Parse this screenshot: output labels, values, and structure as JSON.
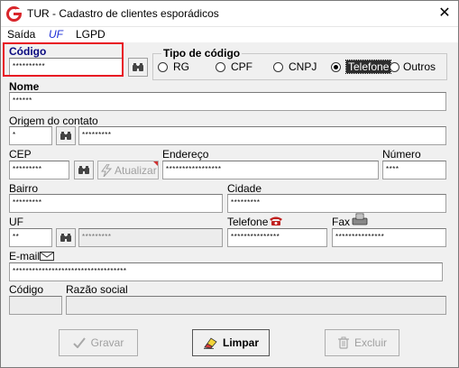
{
  "window": {
    "title": "TUR - Cadastro de clientes esporádicos",
    "close_glyph": "✕"
  },
  "menu": {
    "items": [
      "Saída",
      "UF",
      "LGPD"
    ]
  },
  "form": {
    "codigo": {
      "label": "Código",
      "value": "**********"
    },
    "tipo_codigo": {
      "title": "Tipo de código",
      "options": [
        "RG",
        "CPF",
        "CNPJ",
        "Telefone",
        "Outros"
      ],
      "selected": "Telefone"
    },
    "nome": {
      "label": "Nome",
      "value": "******"
    },
    "origem": {
      "label": "Origem do contato",
      "code": "*",
      "desc": "*********"
    },
    "cep": {
      "label": "CEP",
      "value": "*********"
    },
    "atualizar": {
      "label": "Atualizar"
    },
    "endereco": {
      "label": "Endereço",
      "value": "*****************"
    },
    "numero": {
      "label": "Número",
      "value": "****"
    },
    "bairro": {
      "label": "Bairro",
      "value": "*********"
    },
    "cidade": {
      "label": "Cidade",
      "value": "*********"
    },
    "uf": {
      "label": "UF",
      "code": "**",
      "desc": "*********"
    },
    "telefone": {
      "label": "Telefone",
      "value": "***************"
    },
    "fax": {
      "label": "Fax",
      "value": "***************"
    },
    "email": {
      "label": "E-mail",
      "value": "***********************************"
    },
    "codigo_empresa": {
      "label": "Código"
    },
    "razao_social": {
      "label": "Razão social"
    }
  },
  "buttons": {
    "gravar": "Gravar",
    "limpar": "Limpar",
    "excluir": "Excluir"
  },
  "colors": {
    "highlight_box": "#e81123",
    "menu_uf": "#1a2bd6",
    "app_icon": "#d9262b"
  }
}
